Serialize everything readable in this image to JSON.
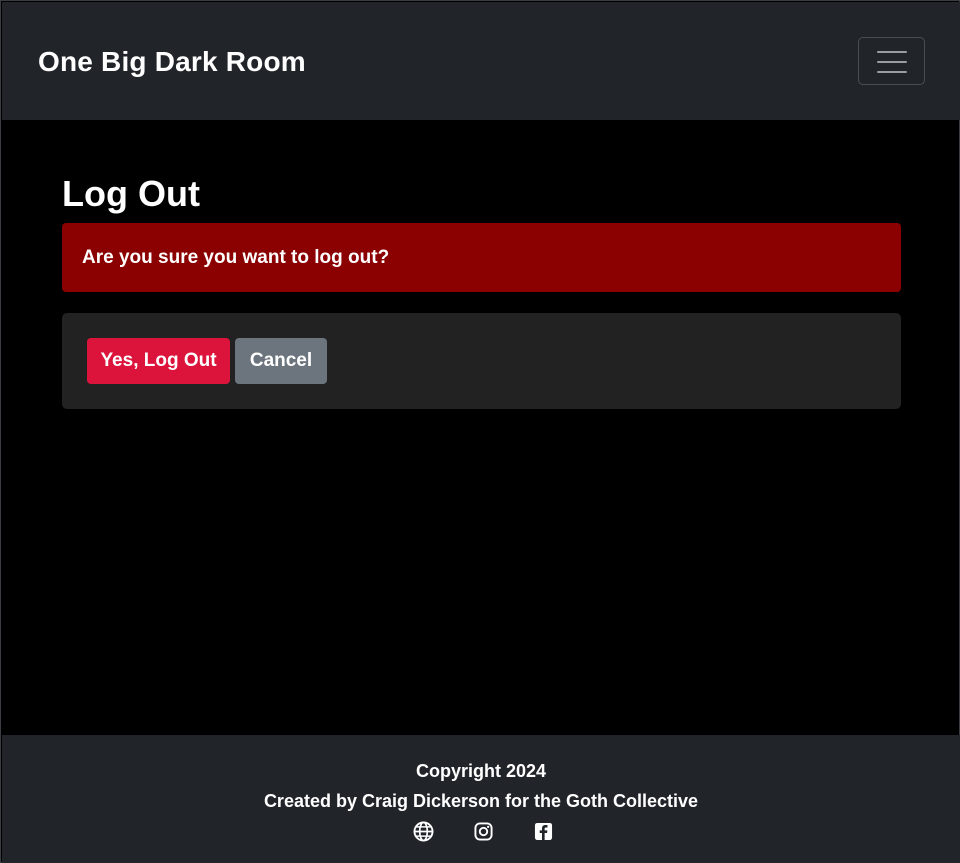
{
  "header": {
    "brand": "One Big Dark Room",
    "menu_toggle_icon": "hamburger-icon"
  },
  "main": {
    "title": "Log Out",
    "alert_message": "Are you sure you want to log out?",
    "confirm_label": "Yes, Log Out",
    "cancel_label": "Cancel"
  },
  "footer": {
    "copyright": "Copyright 2024",
    "credit": "Created by Craig Dickerson for the Goth Collective",
    "social_icons": [
      "globe-icon",
      "instagram-icon",
      "facebook-icon"
    ]
  },
  "colors": {
    "navbar_bg": "#212529",
    "page_bg": "#000000",
    "alert_bg": "#8b0000",
    "card_bg": "#222222",
    "danger_button": "#dc143c",
    "secondary_button": "#6c757d"
  }
}
